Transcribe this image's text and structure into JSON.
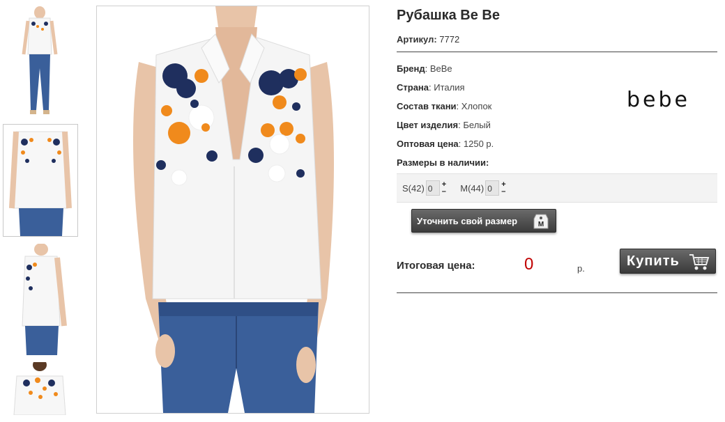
{
  "product": {
    "title": "Рубашка Be Be",
    "article_label": "Артикул:",
    "article_value": "7772",
    "brand_label": "Бренд",
    "brand_value": "BeBe",
    "country_label": "Страна",
    "country_value": "Италия",
    "fabric_label": "Состав ткани",
    "fabric_value": "Хлопок",
    "color_label": "Цвет изделия",
    "color_value": "Белый",
    "price_label": "Оптовая цена",
    "price_value": "1250 р.",
    "sizes_label": "Размеры в наличии:",
    "brand_logo_text": "bebe"
  },
  "sizes": [
    {
      "label": "S(42)",
      "qty": "0",
      "plus": "+",
      "minus": "–"
    },
    {
      "label": "M(44)",
      "qty": "0",
      "plus": "+",
      "minus": "–"
    }
  ],
  "buttons": {
    "size_button": "Уточнить свой размер",
    "size_tag_letter": "M",
    "buy_button": "Купить"
  },
  "total": {
    "label": "Итоговая цена:",
    "value": "0",
    "currency": "р."
  },
  "colors": {
    "navy": "#1f2f5e",
    "orange": "#f08a1c",
    "denim": "#3a5f9a",
    "price_red": "#c00000"
  },
  "thumbnails": [
    {
      "icon": "full-body-front"
    },
    {
      "icon": "front-closeup",
      "active": true
    },
    {
      "icon": "side-view"
    },
    {
      "icon": "back-view"
    }
  ]
}
